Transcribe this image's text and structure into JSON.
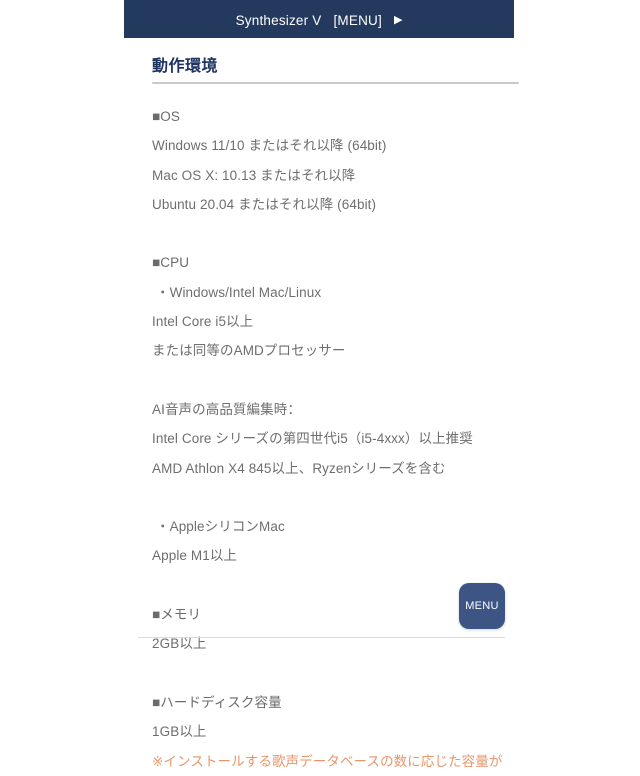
{
  "header": {
    "brand": "Synthesizer V",
    "menu_label": "[MENU]",
    "caret_icon": "▶",
    "background_color": "#23395d"
  },
  "title": "動作環境",
  "sections": [
    {
      "heading": "■OS",
      "lines": [
        "Windows 11/10 またはそれ以降 (64bit)",
        "Mac OS X: 10.13 またはそれ以降",
        "Ubuntu 20.04 またはそれ以降 (64bit)"
      ]
    },
    {
      "heading": "■CPU",
      "bullet": "・Windows/Intel Mac/Linux",
      "lines": [
        "Intel Core i5以上",
        "または同等のAMDプロセッサー"
      ],
      "lines2": [
        "AI音声の高品質編集時：",
        "Intel Core シリーズの第四世代i5（i5-4xxx）以上推奨",
        "AMD Athlon X4 845以上、Ryzenシリーズを含む"
      ],
      "bullet2": "・AppleシリコンMac",
      "lines3": [
        "Apple M1以上"
      ]
    },
    {
      "heading": "■メモリ",
      "lines": [
        "2GB以上"
      ]
    },
    {
      "heading": "■ハードディスク容量",
      "lines": [
        "1GB以上"
      ],
      "note": "※インストールする歌声データベースの数に応じた容量が"
    }
  ],
  "fab": {
    "label": "MENU",
    "color": "#3c5584"
  },
  "colors": {
    "navy": "#23395d",
    "title": "#1f3461",
    "body_text": "#6e6e6e",
    "note_orange": "#e8966b"
  }
}
